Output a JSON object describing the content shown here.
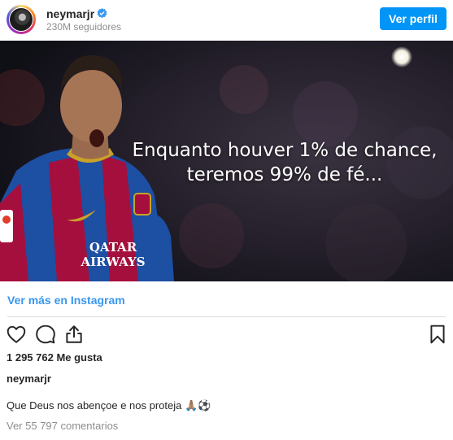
{
  "header": {
    "username": "neymarjr",
    "followers": "230M seguidores",
    "view_profile_label": "Ver perfil",
    "verified_icon": "verified-badge-icon"
  },
  "post": {
    "image_text_line1": "Enquanto houver 1% de chance,",
    "image_text_line2": "teremos 99% de fé...",
    "jersey_text": "QATAR AIRWAYS",
    "more_link": "Ver más en Instagram"
  },
  "actions": {
    "icons": [
      "heart-icon",
      "comment-icon",
      "share-icon",
      "bookmark-icon"
    ]
  },
  "stats": {
    "likes": "1 295 762 Me gusta"
  },
  "caption": {
    "username": "neymarjr",
    "text": "Que Deus nos abençoe e nos proteja 🙏🏽⚽",
    "comments_link": "Ver 55 797 comentarios"
  },
  "colors": {
    "accent": "#0095f6",
    "link": "#3897f0",
    "muted": "#8e8e8e",
    "jersey_blue": "#1d4fa3",
    "jersey_red": "#a50f3d"
  }
}
